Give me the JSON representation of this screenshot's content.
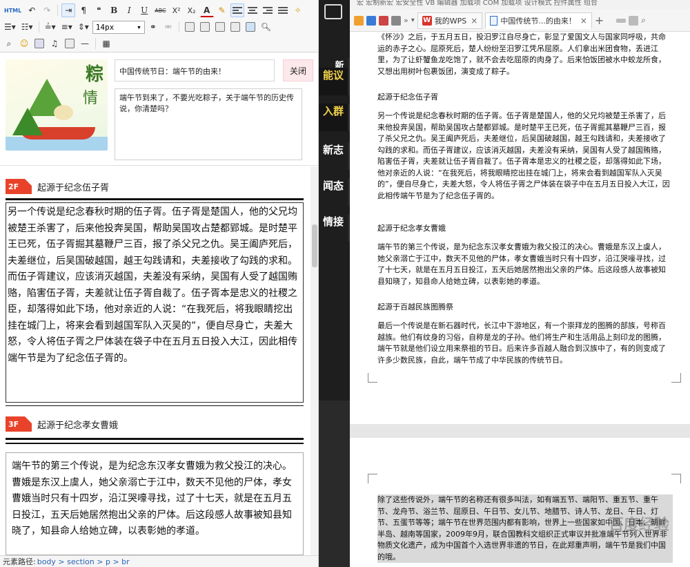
{
  "editor": {
    "toolbar": {
      "html_label": "HTML",
      "font_size": "14px",
      "buttons": [
        "undo-icon",
        "redo-icon",
        "ltr-icon",
        "rtl-icon",
        "paragraph-icon",
        "bold",
        "italic",
        "underline",
        "strikethrough",
        "superscript",
        "subscript",
        "font-color",
        "highlight",
        "align-left",
        "align-center",
        "align-right",
        "justify",
        "clear-format"
      ],
      "bold_label": "B",
      "italic_label": "I",
      "underline_label": "U",
      "strike_label": "ABC",
      "sup_label": "X²",
      "sub_label": "X₂",
      "fontcolor_label": "A"
    },
    "post": {
      "title": "中国传统节日：端午节的由来！",
      "close_label": "关闭",
      "intro": "端午节到来了，不要光吃粽子，关于端午节的历史传说，你清楚吗？",
      "thumb_text_1": "粽",
      "thumb_text_2": "情"
    },
    "sections": [
      {
        "badge": "2F",
        "title": "起源于纪念伍子胥",
        "body": "另一个传说是纪念春秋时期的伍子胥。伍子胥是楚国人，他的父兄均被楚王杀害了，后来他投奔吴国，帮助吴国攻占楚都郢城。是时楚平王已死，伍子胥掘其墓鞭尸三百，报了杀父兄之仇。吴王阖庐死后，夫差继位，后吴国破越国，越王勾践请和，夫差接收了勾践的求和。而伍子胥建议，应该消灭越国，夫差没有采纳，吴国有人受了越国贿赂，陷害伍子胥，夫差就让伍子胥自裁了。伍子胥本是忠义的社稷之臣，却落得如此下场，他对亲近的人说：“在我死后，将我眼睛挖出挂在城门上，将来会看到越国军队入灭吴的”，便自尽身亡，夫差大怒，令人将伍子胥之尸体装在袋子中在五月五日投入大江，因此相传端午节是为了纪念伍子胥的。"
      },
      {
        "badge": "3F",
        "title": "起源于纪念孝女曹娥",
        "body": "端午节的第三个传说，是为纪念东汉孝女曹娥为救父投江的决心。曹娥是东汉上虞人，她父亲溺亡于江中，数天不见他的尸体，孝女曹娥当时只有十四岁，沿江哭嚎寻找，过了十七天，就是在五月五日投江，五天后她居然抱出父亲的尸体。后这段感人故事被知县知晓了，知县命人给她立碑，以表彰她的孝道。"
      }
    ],
    "status": {
      "label": "元素路径:",
      "path": "body > section > p > br"
    }
  },
  "side_panel": {
    "links": [
      {
        "text": "新"
      },
      {
        "text": "能议"
      },
      {
        "text": "入群"
      },
      {
        "text": "新志"
      },
      {
        "text": "闻态"
      },
      {
        "text": "情接"
      }
    ]
  },
  "wps": {
    "top_strip": "宏   宏制新宏   宏安全性   VB 编辑器   加载项   COM 加载项   设计模式   控件属性   组合",
    "tabs": [
      {
        "label": "我的WPS"
      },
      {
        "label": "中国传统节...的由来！"
      }
    ],
    "page1": {
      "intro": "《怀沙》之后，于五月五日，投汨罗江自尽身亡，彰显了爱国文人与国家同呼吸，共命运的赤子之心。屈原死后，楚人纷纷至汨罗江凭吊屈原。人们拿出米团食物，丢进江里，为了让虾蟹鱼龙吃饱了，就不会去吃屈原的肉身了。后来怕饭团被水中蛟龙所食，又想出用树叶包裹饭团，演变成了粽子。",
      "h2": "起源于纪念伍子胥",
      "p2": "另一个传说是纪念春秋时期的伍子胥。伍子胥是楚国人，他的父兄均被楚王杀害了，后来他投奔吴国，帮助吴国攻占楚都郢城。是时楚平王已死，伍子胥掘其墓鞭尸三百，报了杀父兄之仇。吴王阖庐死后，夫差继位，后吴国破越国，越王勾践请和，夫差接收了勾践的求和。而伍子胥建议，应该消灭越国，夫差没有采纳，吴国有人受了越国贿赂，陷害伍子胥，夫差就让伍子胥自裁了。伍子胥本是忠义的社稷之臣，却落得如此下场，他对亲近的人说：“在我死后，将我眼睛挖出挂在城门上，将来会看到越国军队入灭吴的”，便自尽身亡，夫差大怒，令人将伍子胥之尸体装在袋子中在五月五日投入大江，因此相传端午节是为了纪念伍子胥的。",
      "h3": "起源于纪念孝女曹娥",
      "p3": "端午节的第三个传说，是为纪念东汉孝女曹娥为救父投江的决心。曹娥是东汉上虞人，她父亲溺亡于江中，数天不见他的尸体，孝女曹娥当时只有十四岁，沿江哭嚎寻找，过了十七天，就是在五月五日投江，五天后她居然抱出父亲的尸体。后这段感人故事被知县知晓了，知县命人给她立碑，以表彰她的孝道。",
      "h4": "起源于百越民族图腾祭",
      "p4": "最后一个传说是在新石器时代，长江中下游地区，有一个崇拜龙的图腾的部族，号称百越族。他们有纹身的习俗，自称是龙的子孙。他们将生产和生活用品上刻印龙的图腾，端午节就是他们设立用来祭祖的节日。后来许多百越人融合到汉族中了，有的则变成了许多少数民族，自此，端午节成了中华民族的传统节日。"
    },
    "page2": {
      "p1": "除了这些传说外，端午节的名称还有很多叫法，如有端五节、端阳节、重五节、重午节、龙舟节、浴兰节、屈原日、午日节、女儿节、地腊节、诗人节、龙日、午日、灯节、五蛋节等等；端午节在世界范围内都有影响，世界上一些国家如中国、日本、朝鲜半岛、越南等国家，2009年9月，联合国教科文组织正式审议并批准端午节列入世界非物质文化遗产，成为中国首个入选世界非遗的节日，在此郑重声明，端午节是我们中国的哦。",
      "watermark": "百度经验"
    }
  },
  "colors": {
    "badge": "#e8432a",
    "link_yellow": "#f3d34a",
    "wps_red": "#d8342c",
    "selection": "#d9d9d9"
  }
}
